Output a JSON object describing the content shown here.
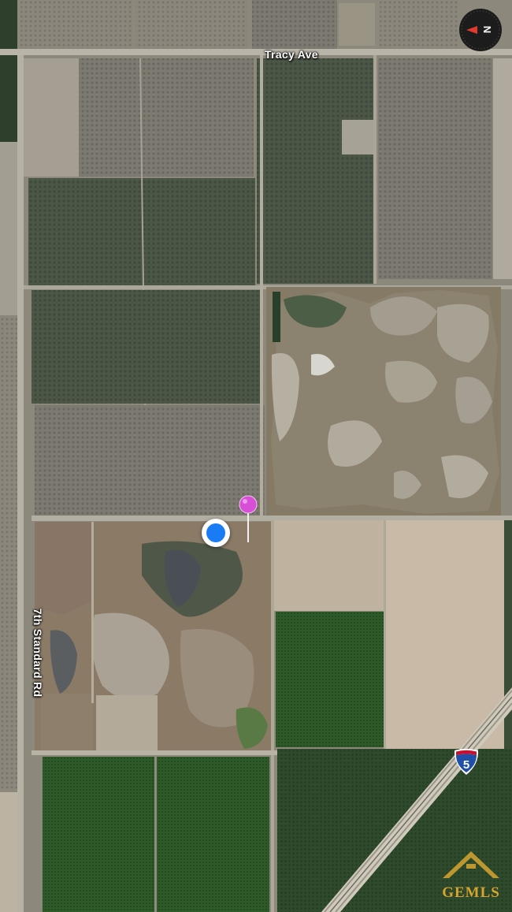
{
  "map": {
    "view": "satellite",
    "roads": {
      "tracy_ave": "Tracy Ave",
      "seventh_standard": "7th Standard Rd",
      "interstate_number": "5"
    },
    "compass": {
      "letter": "N",
      "icon": "compass-icon"
    },
    "markers": {
      "user_location": "user-location-dot",
      "dropped_pin": "pin-icon"
    },
    "watermark": {
      "text": "GEMLS"
    },
    "colors": {
      "user_location": "#1a7cf5",
      "pin": "#d64fd6",
      "interstate_shield": "#1f4fa8",
      "watermark": "#d6a531"
    }
  }
}
